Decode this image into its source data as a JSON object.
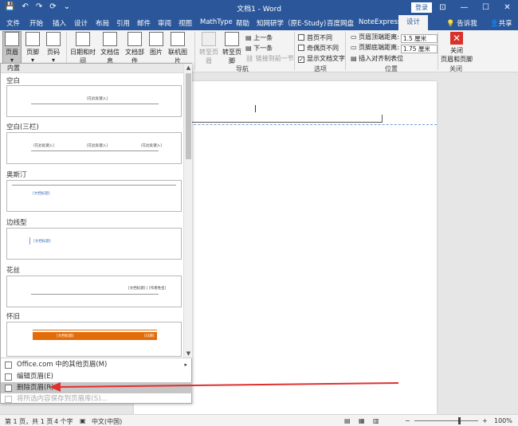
{
  "window": {
    "title": "文档1 - Word",
    "login": "登录",
    "qat": [
      "💾",
      "↶",
      "↷",
      "⟳",
      "⌄"
    ],
    "controls": [
      "⊡",
      "—",
      "☐",
      "✕"
    ]
  },
  "tabs": [
    "文件",
    "开始",
    "插入",
    "设计",
    "布局",
    "引用",
    "邮件",
    "审阅",
    "视图",
    "MathType",
    "帮助",
    "知网研学（原E-Study)",
    "百度网盘",
    "NoteExpress",
    "设计"
  ],
  "tell_me": "告诉我",
  "share": "共享",
  "ribbon": {
    "header": "页眉",
    "footer": "页脚",
    "page_number": "页码",
    "date_time": "日期和时间",
    "doc_info": "文档信息",
    "doc_parts": "文档部件",
    "picture": "图片",
    "online_picture": "联机图片",
    "goto_header": "转至页眉",
    "goto_footer": "转至页脚",
    "prev": "上一条",
    "next": "下一条",
    "link_prev": "链接到前一节",
    "nav_group": "导航",
    "diff_first": "首页不同",
    "diff_odd_even": "奇偶页不同",
    "show_text": "显示文档文字",
    "options_group": "选项",
    "header_top": "页眉顶端距离:",
    "header_top_val": "1.5 厘米",
    "footer_bottom": "页脚底端距离:",
    "footer_bottom_val": "1.75 厘米",
    "align_tab": "插入对齐制表位",
    "position_group": "位置",
    "close_line1": "关闭",
    "close_line2": "页眉和页脚",
    "close_group": "关闭"
  },
  "gallery": {
    "category": "内置",
    "items": [
      {
        "label": "空白",
        "placeholders": [
          "[在此处键入]"
        ]
      },
      {
        "label": "空白(三栏)",
        "placeholders": [
          "[在此处键入]",
          "[在此处键入]",
          "[在此处键入]"
        ]
      },
      {
        "label": "奥斯汀",
        "placeholders": [
          "[文档标题]"
        ]
      },
      {
        "label": "边线型",
        "placeholders": [
          "[文档标题]"
        ]
      },
      {
        "label": "花丝",
        "placeholders": [
          "[文档标题] | [作者姓名]"
        ]
      },
      {
        "label": "怀旧",
        "placeholders": [
          "[文档标题]",
          "[日期]"
        ]
      }
    ],
    "menu": {
      "more": "Office.com 中的其他页眉(M)",
      "edit": "编辑页眉(E)",
      "remove": "删除页眉(R)",
      "save": "将所选内容保存到页眉库(S)..."
    }
  },
  "status": {
    "page": "第 1 页，共 1 页",
    "words": "4 个字",
    "language": "中文(中国)",
    "zoom": "100%",
    "zoom_minus": "−",
    "zoom_plus": "+"
  },
  "colors": {
    "accent": "#2b579a",
    "arrow": "#e03030",
    "orange": "#e36c0a"
  }
}
